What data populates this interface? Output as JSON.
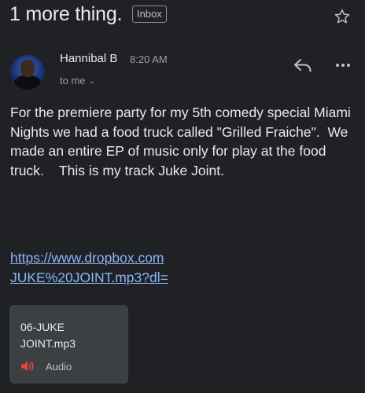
{
  "subject": "1 more thing.",
  "label_chip": "Inbox",
  "sender": {
    "name": "Hannibal B",
    "time": "8:20 AM",
    "recipient": "to me"
  },
  "body": {
    "paragraph": "For the premiere party for my 5th comedy special Miami Nights we had a food truck called \"Grilled Fraiche\".  We made an entire EP of music only for play at the food truck.    This is my track Juke Joint.",
    "link_line1": "https://www.dropbox.com",
    "link_line2": "JUKE%20JOINT.mp3?dl="
  },
  "attachment": {
    "name_line1": "06-JUKE",
    "name_line2": "JOINT.mp3",
    "type": "Audio",
    "icon": "audio-icon",
    "icon_color": "#e8453c"
  },
  "icons": {
    "star": "star-icon",
    "reply": "reply-icon",
    "more": "more-icon"
  },
  "colors": {
    "background": "#202124",
    "link": "#8ab4f8",
    "card": "#3c4043"
  }
}
